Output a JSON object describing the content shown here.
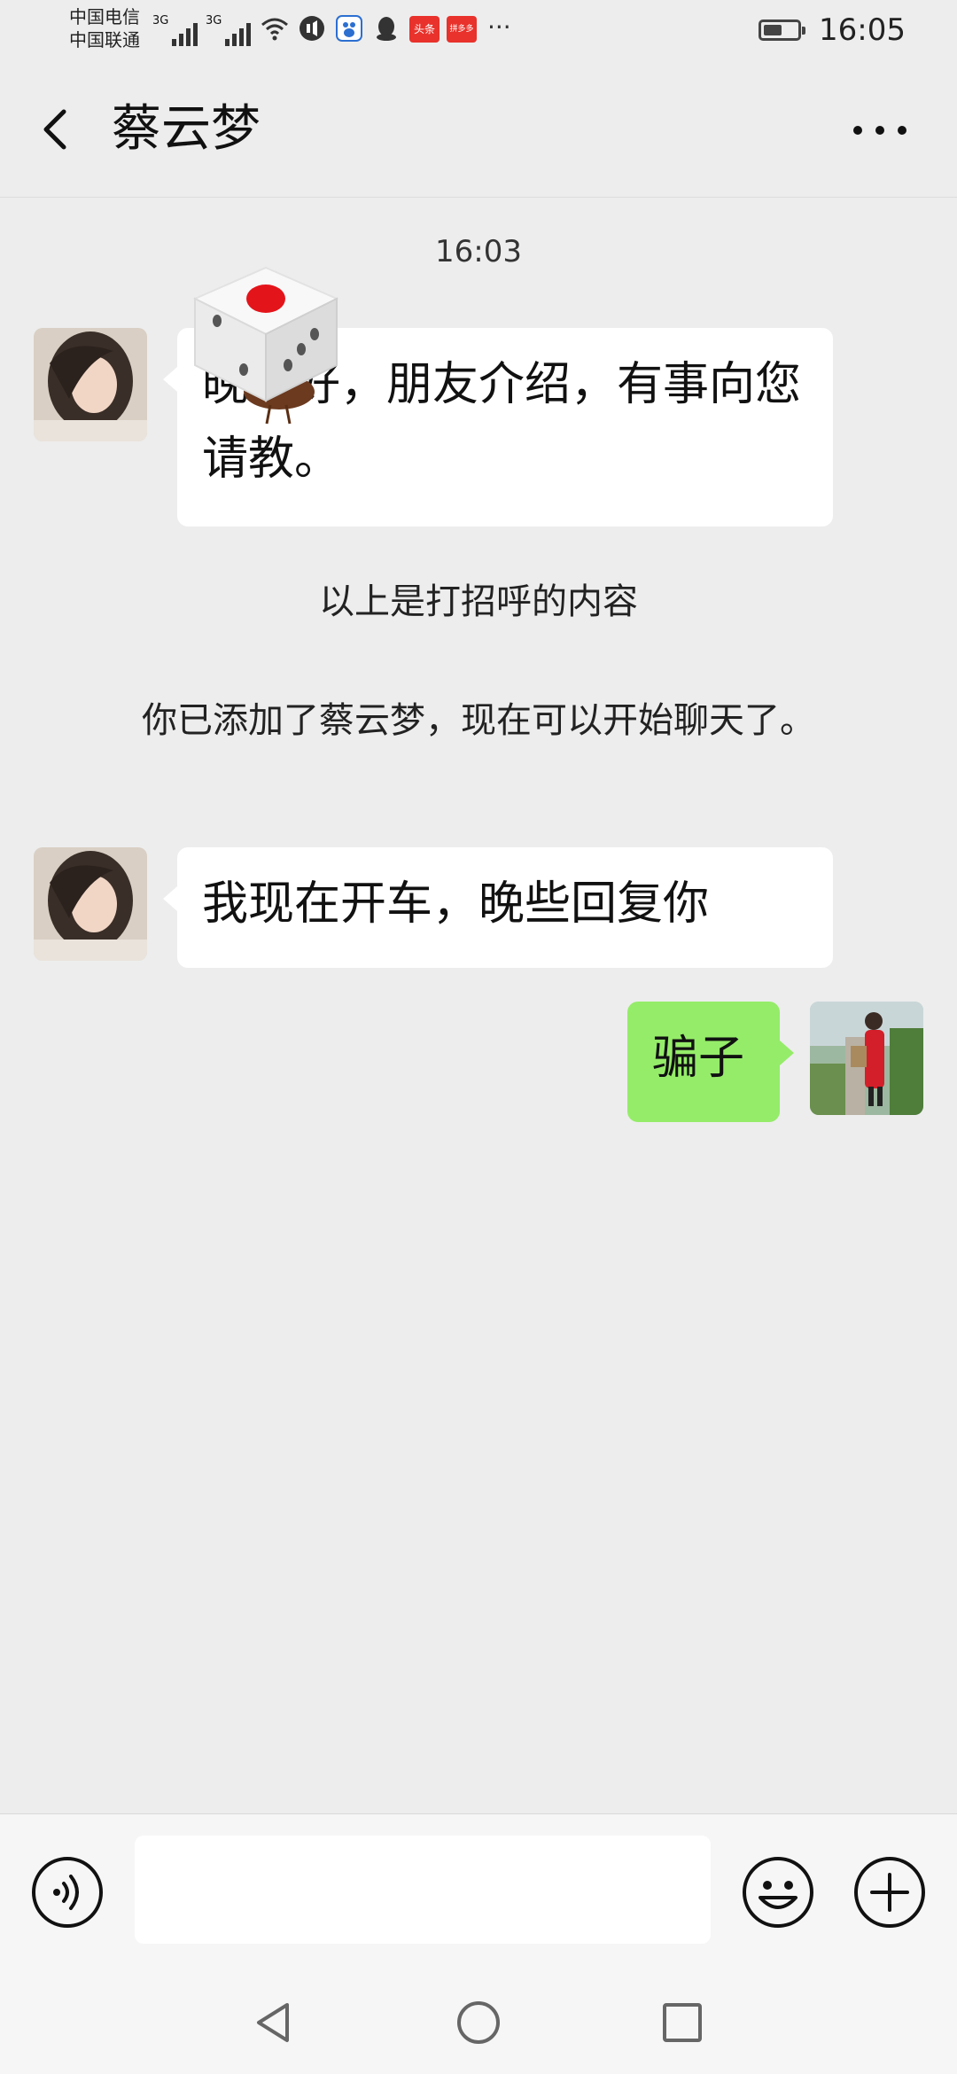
{
  "status_bar": {
    "carrier_1": "中国电信",
    "carrier_2": "中国联通",
    "net_1": "3G",
    "net_2": "3G",
    "time": "16:05",
    "more": "···",
    "app_badges": [
      "头条",
      "拼多多"
    ],
    "battery_level": 0.55
  },
  "header": {
    "title": "蔡云梦",
    "back_icon": "chevron-left-icon",
    "more_icon": "more-dots-icon"
  },
  "chat": {
    "timestamp": "16:03",
    "messages": [
      {
        "side": "left",
        "text": "晚上好，朋友介绍，有事向您请教。"
      },
      {
        "side": "left",
        "text": "我现在开车，晚些回复你"
      },
      {
        "side": "right",
        "text": "骗子"
      }
    ],
    "system_notes": [
      "以上是打招呼的内容",
      "你已添加了蔡云梦，现在可以开始聊天了。"
    ]
  },
  "input_bar": {
    "value": "",
    "voice_icon": "voice-icon",
    "emoji_icon": "emoji-icon",
    "plus_icon": "plus-icon"
  },
  "colors": {
    "background": "#ededed",
    "bubble_left": "#ffffff",
    "bubble_right": "#95ec69"
  }
}
